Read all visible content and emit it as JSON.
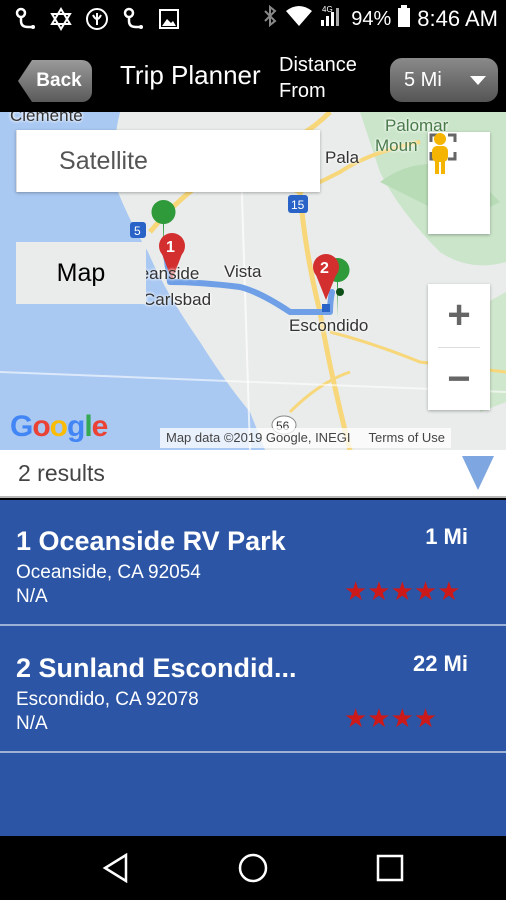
{
  "status_bar": {
    "battery_pct": "94%",
    "time": "8:46 AM",
    "icons": [
      "usb-icon",
      "star-of-david-icon",
      "vpn-icon",
      "usb-icon",
      "image-icon",
      "bluetooth-icon",
      "wifi-icon",
      "signal-icon",
      "battery-icon"
    ],
    "network_badge": "4G"
  },
  "header": {
    "back_label": "Back",
    "title": "Trip Planner",
    "distance_line1": "Distance",
    "distance_line2": "From",
    "distance_value": "5 Mi"
  },
  "map": {
    "toggle_map": "Map",
    "toggle_satellite": "Satellite",
    "google_logo": "Google",
    "attribution": "Map data ©2019 Google, INEGI",
    "terms": "Terms of Use",
    "labels": {
      "clemente": "Clemente",
      "oceanside": "Oceanside",
      "vista": "Vista",
      "carlsbad": "Carlsbad",
      "escondido": "Escondido",
      "pala": "Pala",
      "palomar_1": "Palomar",
      "palomar_2": "Moun",
      "route_5": "5",
      "route_15": "15",
      "route_56": "56"
    },
    "markers": [
      {
        "label": "1",
        "color": "#d32f2f"
      },
      {
        "label": "2",
        "color": "#d32f2f"
      }
    ],
    "zoom_in": "+",
    "zoom_out": "−"
  },
  "results": {
    "count_label": "2 results"
  },
  "items": [
    {
      "name": "1 Oceanside RV Park",
      "address": "Oceanside, CA 92054",
      "extra": "N/A",
      "distance": "1 Mi",
      "rating": 5,
      "stars": "★★★★★"
    },
    {
      "name": "2 Sunland Escondid...",
      "address": "Escondido, CA 92078",
      "extra": "N/A",
      "distance": "22 Mi",
      "rating": 4,
      "stars": "★★★★"
    }
  ],
  "colors": {
    "list_bg": "#2c55a5",
    "star": "#cc1a1a",
    "marker_green": "#2e9a3a"
  }
}
